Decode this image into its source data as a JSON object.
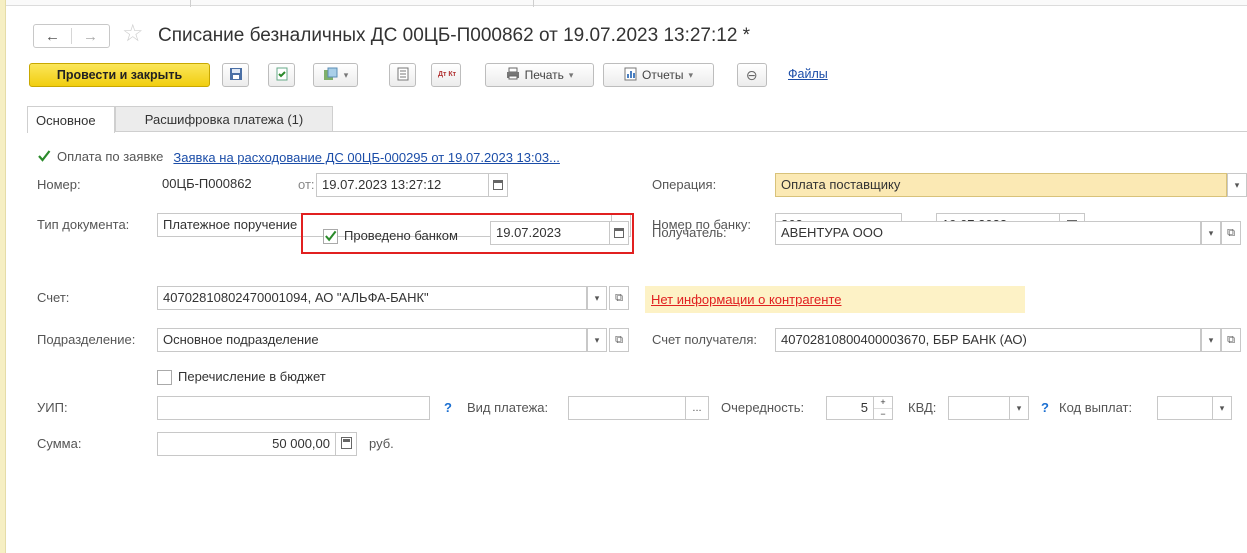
{
  "window": {
    "title": "Списание безналичных ДС 00ЦБ-П000862 от 19.07.2023 13:27:12 *",
    "back_glyph": "←",
    "forward_glyph": "→",
    "favorite_glyph": "☆"
  },
  "toolbar": {
    "post_and_close": "Провести и закрыть",
    "print": "Печать",
    "reports": "Отчеты",
    "files": "Файлы",
    "dtkt": "Дт Кт",
    "icons": [
      "save-icon",
      "post-icon",
      "create-based-on-icon",
      "journal-icon",
      "dtkt-icon",
      "printer-icon",
      "reports-icon",
      "paperclip-icon"
    ]
  },
  "tabs": [
    {
      "label": "Основное",
      "active": true
    },
    {
      "label": "Расшифровка платежа (1)",
      "active": false
    }
  ],
  "form": {
    "payment_by_request": {
      "label": "Оплата по заявке",
      "checked": true,
      "link": "Заявка на расходование ДС 00ЦБ-000295 от 19.07.2023 13:03..."
    },
    "number": {
      "label": "Номер:",
      "value": "00ЦБ-П000862",
      "from_label": "от:",
      "date": "19.07.2023 13:27:12"
    },
    "doc_type": {
      "label": "Тип документа:",
      "value": "Платежное поручение"
    },
    "bank_posted": {
      "label": "Проведено банком",
      "checked": true,
      "date": "19.07.2023"
    },
    "account": {
      "label": "Счет:",
      "value": "40702810802470001094, АО \"АЛЬФА-БАНК\""
    },
    "department": {
      "label": "Подразделение:",
      "value": "Основное подразделение"
    },
    "budget_transfer": {
      "label": "Перечисление в бюджет",
      "checked": false
    },
    "uip": {
      "label": "УИП:",
      "value": ""
    },
    "payment_kind": {
      "label": "Вид платежа:",
      "value": "",
      "btn": "..."
    },
    "priority": {
      "label": "Очередность:",
      "value": "5"
    },
    "kvd": {
      "label": "КВД:",
      "value": ""
    },
    "payout_code": {
      "label": "Код выплат:",
      "value": ""
    },
    "amount": {
      "label": "Сумма:",
      "value": "50 000,00",
      "currency": "руб."
    },
    "operation": {
      "label": "Операция:",
      "value": "Оплата поставщику"
    },
    "bank_number": {
      "label": "Номер по банку:",
      "value": "862",
      "from_label": "от:",
      "date": "19.07.2023"
    },
    "recipient": {
      "label": "Получатель:",
      "value": "АВЕНТУРА ООО"
    },
    "counterparty_warning": "Нет информации о контрагенте",
    "recipient_account": {
      "label": "Счет получателя:",
      "value": "40702810800400003670, ББР БАНК (АО)"
    },
    "question_mark": "?"
  },
  "colors": {
    "primary_button": "#f1ce10",
    "highlight_border": "#e12020",
    "link": "#1b4da8",
    "operation_field": "#fbe9b4",
    "warning_bg": "#fdf2c6"
  }
}
